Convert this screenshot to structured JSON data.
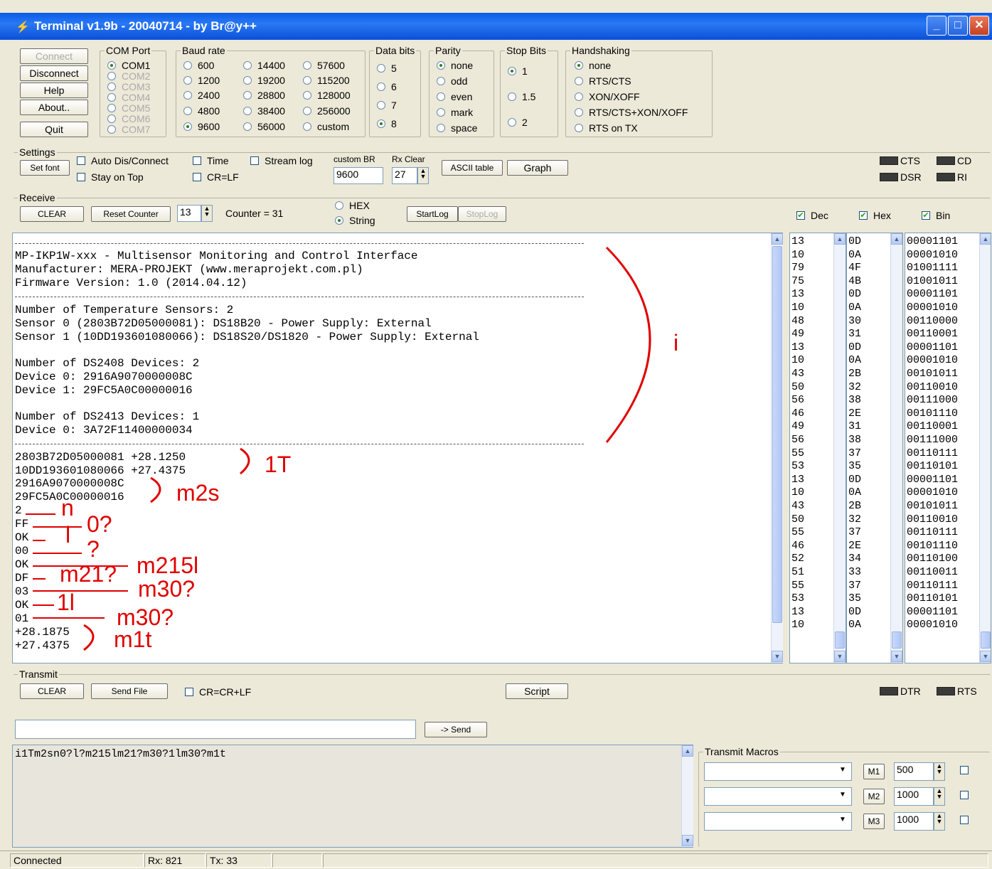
{
  "window": {
    "title": "Terminal v1.9b - 20040714 - by Br@y++"
  },
  "buttons": {
    "connect": "Connect",
    "disconnect": "Disconnect",
    "help": "Help",
    "about": "About..",
    "quit": "Quit"
  },
  "com_port": {
    "label": "COM Port",
    "options": [
      "COM1",
      "COM2",
      "COM3",
      "COM4",
      "COM5",
      "COM6",
      "COM7"
    ],
    "selected": "COM1"
  },
  "baud": {
    "label": "Baud rate",
    "col1": [
      "600",
      "1200",
      "2400",
      "4800",
      "9600"
    ],
    "col2": [
      "14400",
      "19200",
      "28800",
      "38400",
      "56000"
    ],
    "col3": [
      "57600",
      "115200",
      "128000",
      "256000",
      "custom"
    ],
    "selected": "9600"
  },
  "data_bits": {
    "label": "Data bits",
    "options": [
      "5",
      "6",
      "7",
      "8"
    ],
    "selected": "8"
  },
  "parity": {
    "label": "Parity",
    "options": [
      "none",
      "odd",
      "even",
      "mark",
      "space"
    ],
    "selected": "none"
  },
  "stop_bits": {
    "label": "Stop Bits",
    "options": [
      "1",
      "1.5",
      "2"
    ],
    "selected": "1"
  },
  "handshaking": {
    "label": "Handshaking",
    "options": [
      "none",
      "RTS/CTS",
      "XON/XOFF",
      "RTS/CTS+XON/XOFF",
      "RTS on TX"
    ],
    "selected": "none"
  },
  "settings": {
    "label": "Settings",
    "set_font": "Set font",
    "auto_dis": "Auto Dis/Connect",
    "stay_on_top": "Stay on Top",
    "time": "Time",
    "crlf": "CR=LF",
    "stream_log": "Stream log",
    "custom_br_label": "custom BR",
    "custom_br_value": "9600",
    "rx_clear_label": "Rx Clear",
    "rx_clear_value": "27",
    "ascii_table": "ASCII table",
    "graph": "Graph"
  },
  "indicators": {
    "cts": "CTS",
    "cd": "CD",
    "dsr": "DSR",
    "ri": "RI",
    "dtr": "DTR",
    "rts": "RTS"
  },
  "receive": {
    "label": "Receive",
    "clear": "CLEAR",
    "reset_counter": "Reset Counter",
    "counter_spin": "13",
    "counter_text": "Counter = 31",
    "hex": "HEX",
    "string": "String",
    "start_log": "StartLog",
    "stop_log": "StopLog",
    "dec": "Dec",
    "hex_chk": "Hex",
    "bin": "Bin"
  },
  "receive_text": {
    "header": [
      "MP-IKP1W-xxx - Multisensor Monitoring and Control Interface",
      "Manufacturer: MERA-PROJEKT (www.meraprojekt.com.pl)",
      "Firmware Version: 1.0 (2014.04.12)"
    ],
    "temp": [
      "Number of Temperature Sensors: 2",
      "Sensor 0 (2803B72D05000081): DS18B20 - Power Supply: External",
      "Sensor 1 (10DD193601080066): DS18S20/DS1820 - Power Supply: External"
    ],
    "ds2408": [
      "Number of DS2408 Devices: 2",
      "Device 0: 2916A9070000008C",
      "Device 1: 29FC5A0C00000016"
    ],
    "ds2413": [
      "Number of DS2413 Devices: 1",
      "Device 0: 3A72F11400000034"
    ],
    "data": [
      "2803B72D05000081 +28.1250",
      "10DD193601080066 +27.4375",
      "2916A9070000008C",
      "29FC5A0C00000016",
      "2",
      "FF",
      "OK",
      "00",
      "OK",
      "DF",
      "03",
      "OK",
      "01",
      "+28.1875",
      "+27.4375"
    ]
  },
  "dec_col": [
    "13",
    "10",
    "79",
    "75",
    "13",
    "10",
    "48",
    "49",
    "13",
    "10",
    "43",
    "50",
    "56",
    "46",
    "49",
    "56",
    "55",
    "53",
    "13",
    "10",
    "43",
    "50",
    "55",
    "46",
    "52",
    "51",
    "55",
    "53",
    "13",
    "10"
  ],
  "hex_col": [
    "0D",
    "0A",
    "4F",
    "4B",
    "0D",
    "0A",
    "30",
    "31",
    "0D",
    "0A",
    "2B",
    "32",
    "38",
    "2E",
    "31",
    "38",
    "37",
    "35",
    "0D",
    "0A",
    "2B",
    "32",
    "37",
    "2E",
    "34",
    "33",
    "37",
    "35",
    "0D",
    "0A"
  ],
  "bin_col": [
    "00001101",
    "00001010",
    "01001111",
    "01001011",
    "00001101",
    "00001010",
    "00110000",
    "00110001",
    "00001101",
    "00001010",
    "00101011",
    "00110010",
    "00111000",
    "00101110",
    "00110001",
    "00111000",
    "00110111",
    "00110101",
    "00001101",
    "00001010",
    "00101011",
    "00110010",
    "00110111",
    "00101110",
    "00110100",
    "00110011",
    "00110111",
    "00110101",
    "00001101",
    "00001010"
  ],
  "annotations": {
    "i": "i",
    "t1": "1T",
    "m2s": "m2s",
    "n": "n",
    "q0": "0?",
    "l": "l",
    "q": "?",
    "m215l": "m215l",
    "m21q": "m21?",
    "m30q_a": "m30?",
    "l1": "1l",
    "m30q_b": "m30?",
    "m1t": "m1t"
  },
  "transmit": {
    "label": "Transmit",
    "clear": "CLEAR",
    "send_file": "Send File",
    "crcrlf": "CR=CR+LF",
    "script": "Script",
    "input_value": "",
    "send": "-> Send",
    "text": "i1Tm2sn0?l?m215lm21?m30?1lm30?m1t"
  },
  "macros": {
    "label": "Transmit Macros",
    "rows": [
      {
        "btn": "M1",
        "val": "500"
      },
      {
        "btn": "M2",
        "val": "1000"
      },
      {
        "btn": "M3",
        "val": "1000"
      }
    ]
  },
  "status": {
    "connection": "Connected",
    "rx": "Rx: 821",
    "tx": "Tx: 33"
  },
  "colors": {
    "title": "#0a5ce8",
    "annotation": "#e00000",
    "led": "#3a3a3a"
  }
}
